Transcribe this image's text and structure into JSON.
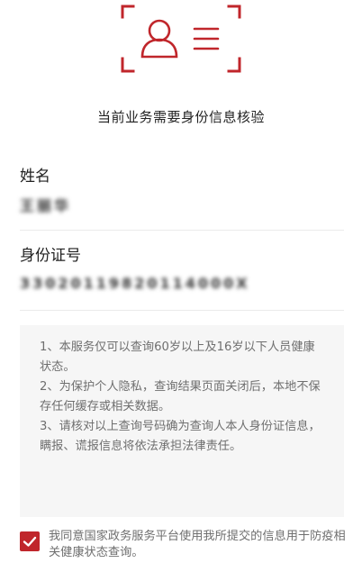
{
  "header": {
    "icon": "id-card-verify-icon",
    "accent_color": "#c0262b",
    "title": "当前业务需要身份信息核验"
  },
  "fields": {
    "name": {
      "label": "姓名",
      "value": "王丽华"
    },
    "id_number": {
      "label": "身份证号",
      "value": "33020119820114000X"
    }
  },
  "notice": {
    "items": [
      "1、本服务仅可以查询60岁以上及16岁以下人员健康状态。",
      "2、为保护个人隐私，查询结果页面关闭后，本地不保存任何缓存或相关数据。",
      "3、请核对以上查询号码确为查询人本人身份证信息，瞒报、谎报信息将依法承担法律责任。"
    ]
  },
  "agreement": {
    "checked": true,
    "text": "我同意国家政务服务平台使用我所提交的信息用于防疫相关健康状态查询。"
  }
}
